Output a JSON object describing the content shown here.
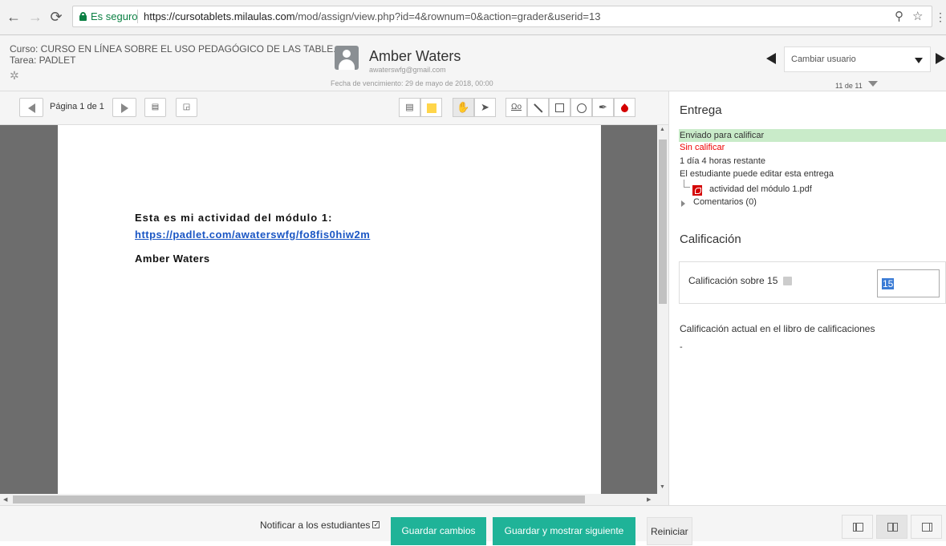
{
  "browser": {
    "secure_label": "Es seguro",
    "url_domain": "https://cursotablets.milaulas.com",
    "url_path": "/mod/assign/view.php?id=4&rownum=0&action=grader&userid=13",
    "back_icon": "back-arrow-icon",
    "forward_icon": "forward-arrow-icon",
    "reload_icon": "reload-icon"
  },
  "header": {
    "course": "Curso: CURSO EN LÍNEA SOBRE EL USO PEDAGÓGICO DE LAS TABLE...",
    "task": "Tarea: PADLET",
    "user_name": "Amber Waters",
    "user_email": "awaterswfg@gmail.com",
    "due_date": "Fecha de vencimiento: 29 de mayo de 2018, 00:00",
    "change_user_placeholder": "Cambiar usuario",
    "user_count": "11 de 11"
  },
  "toolbar": {
    "page_label": "Página 1 de 1"
  },
  "document": {
    "title": "Esta es mi actividad del módulo 1:",
    "link": "https://padlet.com/awaterswfg/fo8fis0hiw2m",
    "author": "Amber Waters"
  },
  "panel": {
    "submission_heading": "Entrega",
    "status_submitted": "Enviado para calificar",
    "status_grade": "Sin calificar",
    "time_remaining": "1 día 4 horas restante",
    "can_edit": "El estudiante puede editar esta entrega",
    "file_name": "actividad del módulo 1.pdf",
    "comments": "Comentarios (0)",
    "grade_heading": "Calificación",
    "grade_label": "Calificación sobre 15",
    "grade_value": "15",
    "gradebook_label": "Calificación actual en el libro de calificaciones",
    "gradebook_value": "-"
  },
  "footer": {
    "notify_label": "Notificar a los estudiantes",
    "save_label": "Guardar cambios",
    "save_next_label": "Guardar y mostrar siguiente",
    "reset_label": "Reiniciar"
  },
  "colors": {
    "accent_button": "#1fb398",
    "status_submitted_bg": "#c9ebc9",
    "status_ungraded": "#e00000",
    "link": "#1a56c4"
  }
}
